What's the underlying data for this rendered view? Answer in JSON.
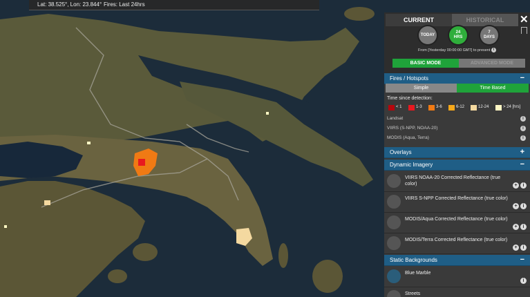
{
  "coord_bar": {
    "lat_lon": "Lat: 38.525°, Lon: 23.844°",
    "fires_filter": "Fires: Last 24hrs"
  },
  "panel": {
    "tabs": {
      "current": "CURRENT",
      "historical": "HISTORICAL"
    },
    "close_glyph": "✕",
    "time_buttons": [
      {
        "label": "TODAY",
        "selected": false
      },
      {
        "label": "24\nHRS",
        "selected": true
      },
      {
        "label": "7\nDAYS",
        "selected": false
      }
    ],
    "from_text": "From [Yesterday 00:00:00 GMT] to present",
    "modes": {
      "basic": "BASIC MODE",
      "advanced": "ADVANCED MODE"
    },
    "fires": {
      "header": "Fires / Hotspots",
      "header_symbol": "−",
      "subtabs": {
        "simple": "Simple",
        "time_based": "Time Based"
      },
      "time_since_label": "Time since detection:",
      "legend": [
        {
          "label": "< 1",
          "color": "#b5060c"
        },
        {
          "label": "1-3",
          "color": "#e8191f"
        },
        {
          "label": "3-6",
          "color": "#f07a14"
        },
        {
          "label": "6-12",
          "color": "#f6a81a"
        },
        {
          "label": "12-24",
          "color": "#f4d9a0"
        },
        {
          "label": "> 24 [hrs]",
          "color": "#fff8c4"
        }
      ],
      "sources": [
        "Landsat",
        "VIIRS (S-NPP, NOAA-20)",
        "MODIS (Aqua, Terra)"
      ],
      "info_glyph": "i"
    },
    "overlays": {
      "header": "Overlays",
      "symbol": "+"
    },
    "dynamic_imagery": {
      "header": "Dynamic Imagery",
      "symbol": "−",
      "items": [
        {
          "label": "VIIRS NOAA-20 Corrected Reflectance (true color)"
        },
        {
          "label": "VIIRS S-NPP Corrected Reflectance (true color)"
        },
        {
          "label": "MODIS/Aqua Corrected Reflectance (true color)"
        },
        {
          "label": "MODIS/Terra Corrected Reflectance (true color)"
        }
      ],
      "plus_glyph": "+",
      "info_glyph": "i"
    },
    "static_backgrounds": {
      "header": "Static Backgrounds",
      "symbol": "−",
      "items": [
        {
          "label": "Blue Marble"
        },
        {
          "label": "Streets"
        }
      ]
    }
  },
  "colors": {
    "accent_green": "#1fa33a",
    "section_blue": "#1f5e86",
    "panel_bg": "#3a3a3a",
    "sea": "#1b2b38"
  }
}
